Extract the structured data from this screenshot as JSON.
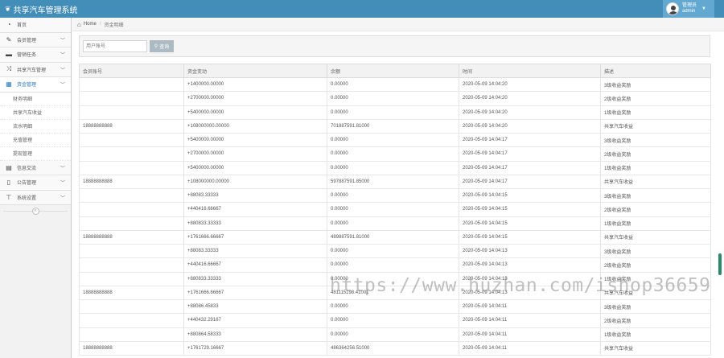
{
  "app": {
    "title": "共享汽车管理系统"
  },
  "user": {
    "name": "管理员",
    "role": "admin"
  },
  "sidebar": {
    "items": [
      {
        "label": "首页",
        "icon": "tachometer-icon"
      },
      {
        "label": "会员管理",
        "icon": "pencil-square-icon"
      },
      {
        "label": "营销任务",
        "icon": "gamepad-icon"
      },
      {
        "label": "共享汽车管理",
        "icon": "shuffle-icon"
      },
      {
        "label": "资金管理",
        "icon": "calendar-icon"
      }
    ],
    "submenu": [
      "财务明细",
      "共享汽车收益",
      "流水明细",
      "充值管理",
      "提现管理"
    ],
    "bottom_items": [
      {
        "label": "信息交流",
        "icon": "list-alt-icon"
      },
      {
        "label": "公告管理",
        "icon": "file-icon"
      },
      {
        "label": "系统设置",
        "icon": "wrench-icon"
      }
    ]
  },
  "breadcrumb": {
    "home": "Home",
    "current": "资金明细"
  },
  "search": {
    "placeholder": "用户账号",
    "button": "查询"
  },
  "table": {
    "columns": [
      "会员账号",
      "资金变动",
      "余额",
      "时间",
      "描述"
    ],
    "rows": [
      {
        "account": "",
        "change": "+1400000.00000",
        "balance": "0.00000",
        "time": "2020-05-09 14:04:20",
        "desc": "3级收益奖励"
      },
      {
        "account": "",
        "change": "+2700000.00000",
        "balance": "0.00000",
        "time": "2020-05-09 14:04:20",
        "desc": "2级收益奖励"
      },
      {
        "account": "",
        "change": "+5400000.00000",
        "balance": "0.00000",
        "time": "2020-05-09 14:04:20",
        "desc": "1级收益奖励"
      },
      {
        "account": "18888888888",
        "change": "+108000000.00000",
        "balance": "701887591.81000",
        "time": "2020-05-09 14:04:20",
        "desc": "共享汽车收益"
      },
      {
        "account": "",
        "change": "+5400000.00000",
        "balance": "0.00000",
        "time": "2020-05-09 14:04:17",
        "desc": "3级收益奖励"
      },
      {
        "account": "",
        "change": "+2700000.00000",
        "balance": "0.00000",
        "time": "2020-05-09 14:04:17",
        "desc": "2级收益奖励"
      },
      {
        "account": "",
        "change": "+5400000.00000",
        "balance": "0.00000",
        "time": "2020-05-09 14:04:17",
        "desc": "1级收益奖励"
      },
      {
        "account": "18888888888",
        "change": "+108000000.00000",
        "balance": "597887591.85000",
        "time": "2020-05-09 14:04:17",
        "desc": "共享汽车收益"
      },
      {
        "account": "",
        "change": "+88083.33333",
        "balance": "0.00000",
        "time": "2020-05-09 14:04:15",
        "desc": "3级收益奖励"
      },
      {
        "account": "",
        "change": "+440416.66667",
        "balance": "0.00000",
        "time": "2020-05-09 14:04:15",
        "desc": "2级收益奖励"
      },
      {
        "account": "",
        "change": "+880833.33333",
        "balance": "0.00000",
        "time": "2020-05-09 14:04:15",
        "desc": "1级收益奖励"
      },
      {
        "account": "18888888888",
        "change": "+1761666.66667",
        "balance": "489887591.81000",
        "time": "2020-05-09 14:04:15",
        "desc": "共享汽车收益"
      },
      {
        "account": "",
        "change": "+88083.33333",
        "balance": "0.00000",
        "time": "2020-05-09 14:04:13",
        "desc": "3级收益奖励"
      },
      {
        "account": "",
        "change": "+440416.66667",
        "balance": "0.00000",
        "time": "2020-05-09 14:04:13",
        "desc": "2级收益奖励"
      },
      {
        "account": "",
        "change": "+880833.33333",
        "balance": "0.00000",
        "time": "2020-05-09 14:04:13",
        "desc": "1级收益奖励"
      },
      {
        "account": "18888888888",
        "change": "+1761666.66667",
        "balance": "481115198.41001",
        "time": "2020-05-09 14:04:13",
        "desc": "共享汽车收益"
      },
      {
        "account": "",
        "change": "+88086.45833",
        "balance": "0.00000",
        "time": "2020-05-09 14:04:11",
        "desc": "3级收益奖励"
      },
      {
        "account": "",
        "change": "+440432.29167",
        "balance": "0.00000",
        "time": "2020-05-09 14:04:11",
        "desc": "2级收益奖励"
      },
      {
        "account": "",
        "change": "+880864.58333",
        "balance": "0.00000",
        "time": "2020-05-09 14:04:11",
        "desc": "1级收益奖励"
      },
      {
        "account": "18888888888",
        "change": "+1761729.16667",
        "balance": "486364256.51000",
        "time": "2020-05-09 14:04:11",
        "desc": "共享汽车收益"
      }
    ]
  },
  "watermark": "https://www.huzhan.com/ishop36659"
}
